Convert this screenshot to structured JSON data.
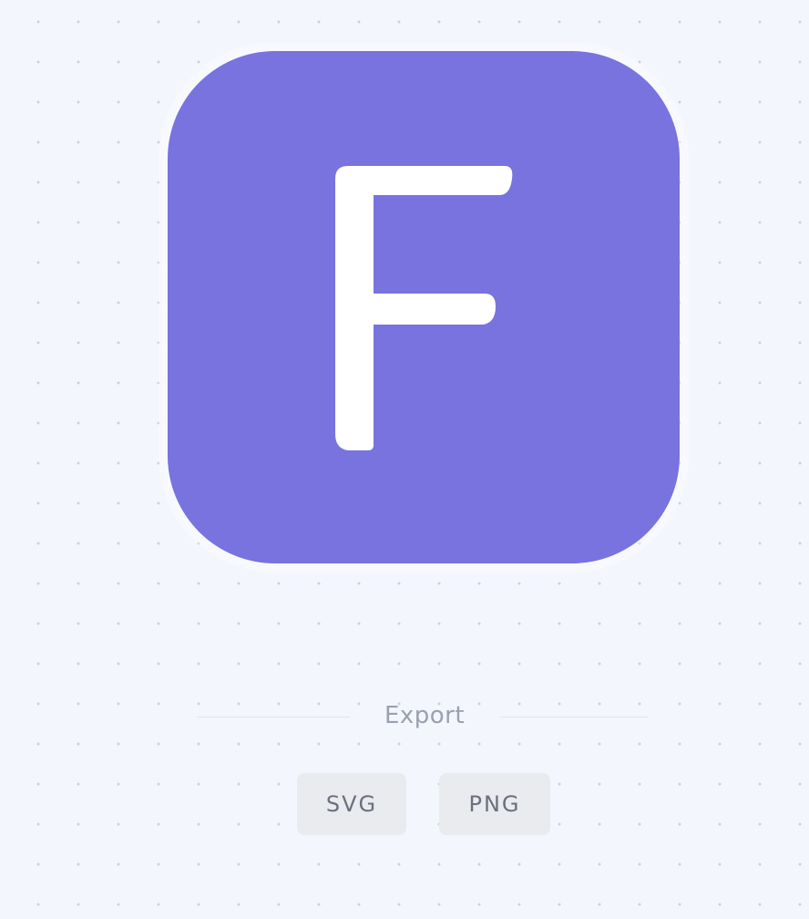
{
  "icon_preview": {
    "letter": "F",
    "background_color": "#7873df",
    "letter_color": "#ffffff"
  },
  "export": {
    "label": "Export",
    "buttons": [
      {
        "label": "SVG"
      },
      {
        "label": "PNG"
      }
    ]
  }
}
